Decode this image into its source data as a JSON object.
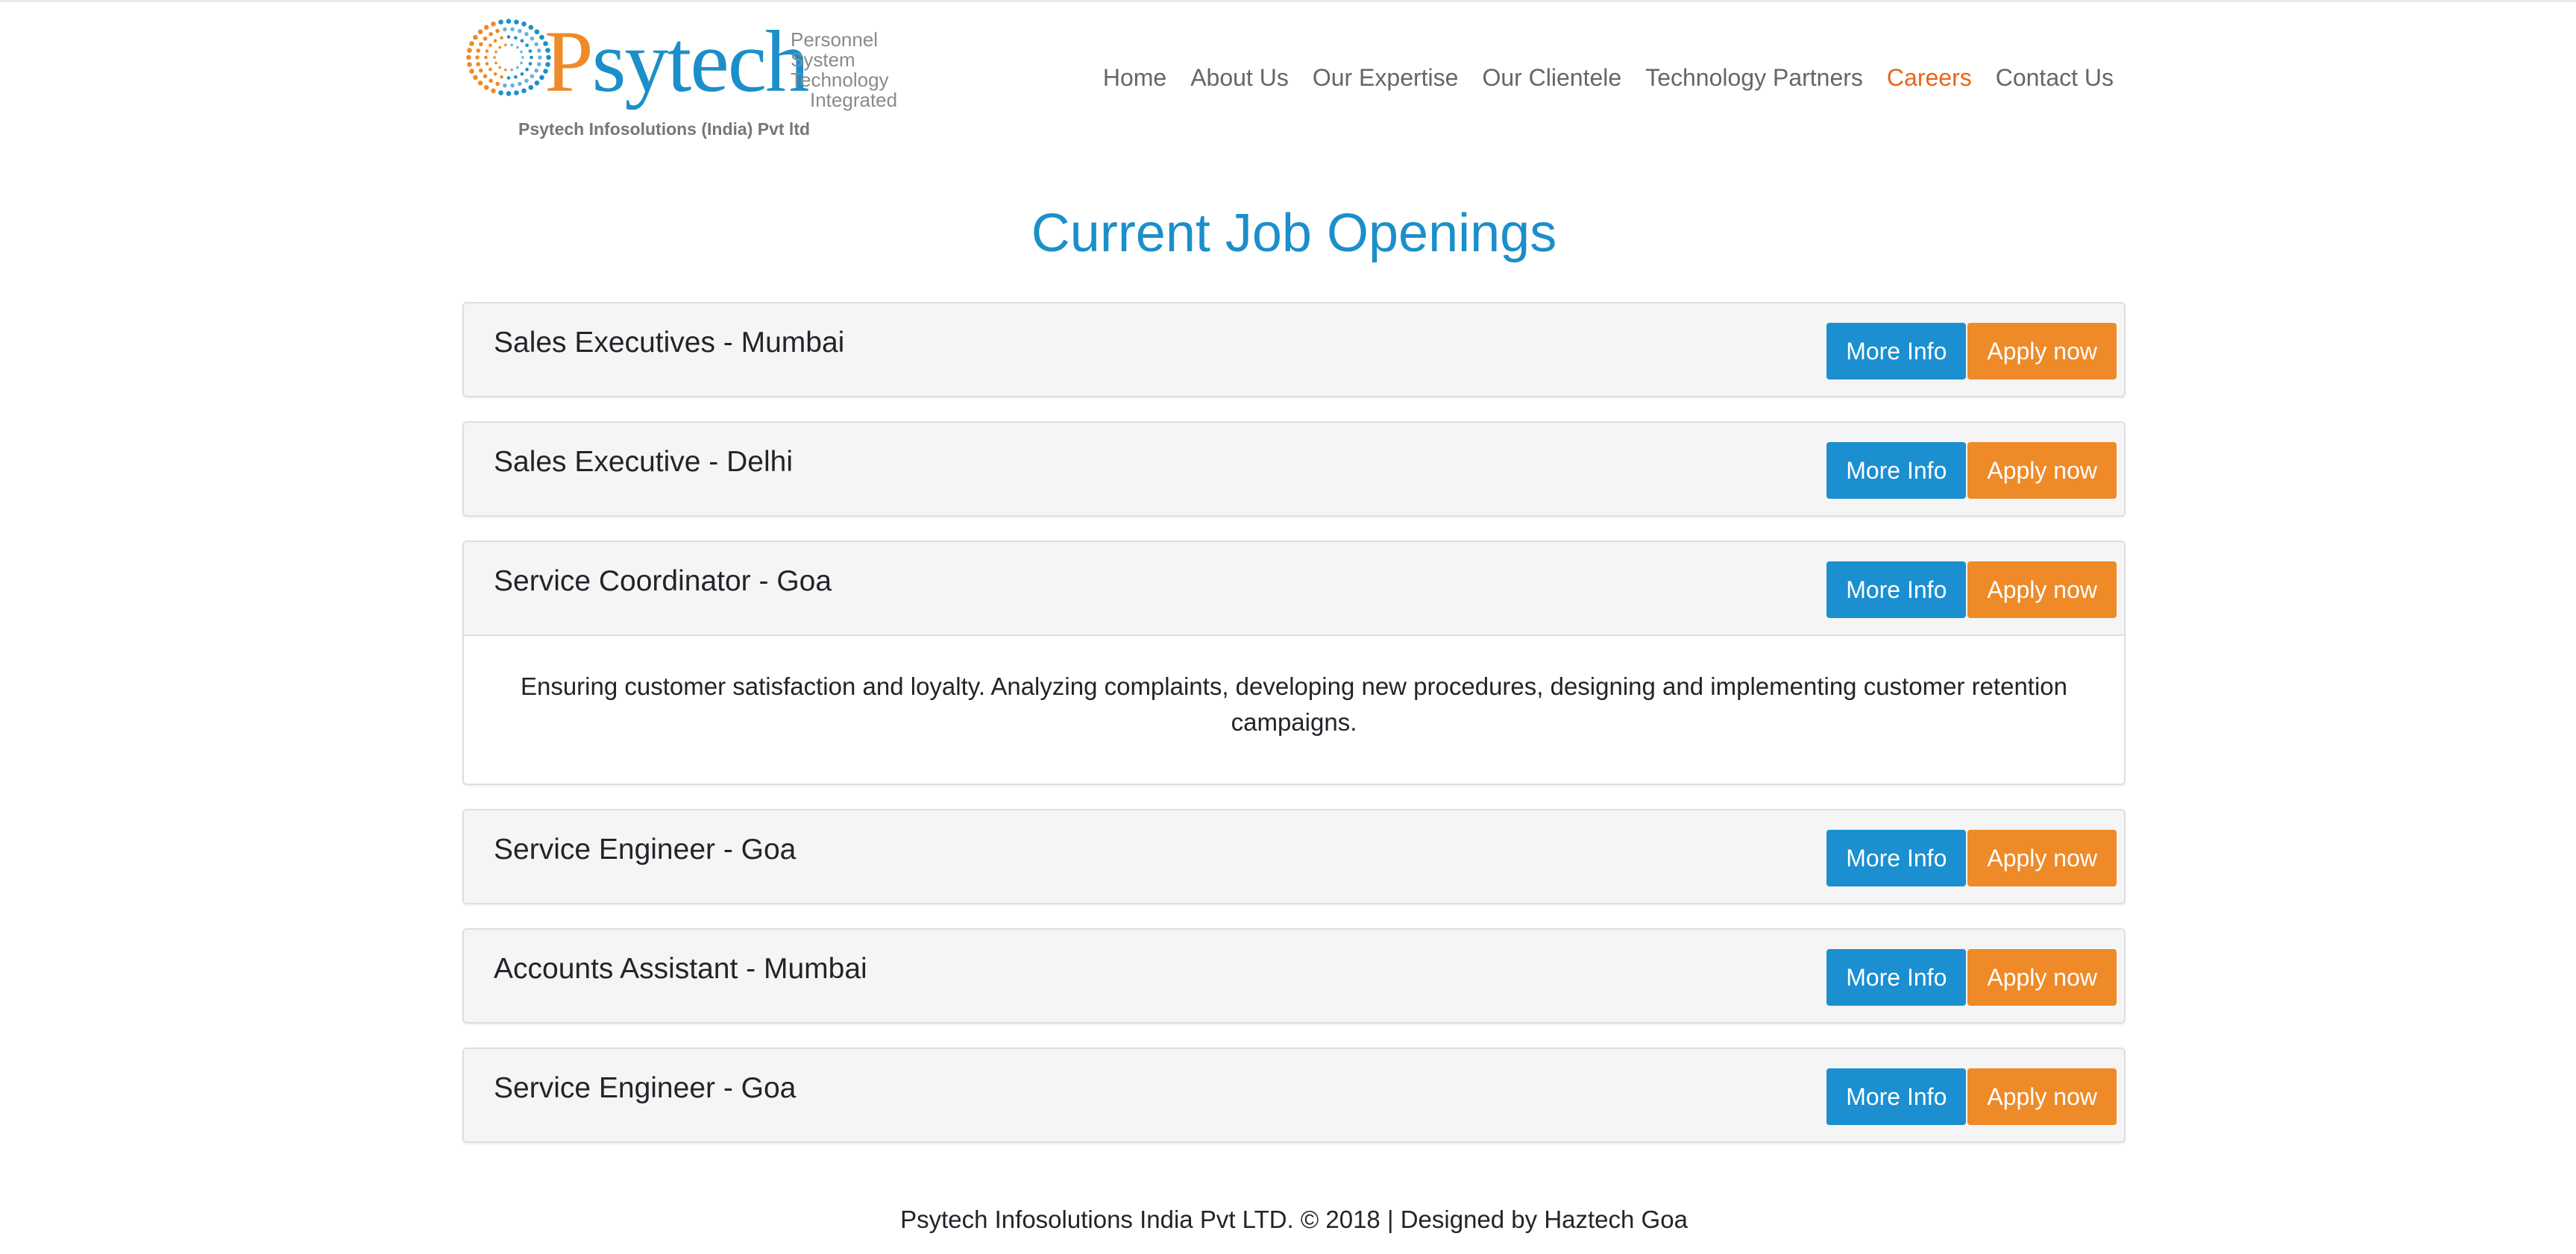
{
  "brand": {
    "logo_word_p": "P",
    "logo_word_rest": "sytech",
    "logo_tagline": [
      "Personnel",
      "System",
      "Technology",
      "Integrated"
    ],
    "company_name": "Psytech Infosolutions (India) Pvt ltd"
  },
  "nav": {
    "items": [
      {
        "label": "Home",
        "active": false
      },
      {
        "label": "About Us",
        "active": false
      },
      {
        "label": "Our Expertise",
        "active": false
      },
      {
        "label": "Our Clientele",
        "active": false
      },
      {
        "label": "Technology Partners",
        "active": false
      },
      {
        "label": "Careers",
        "active": true
      },
      {
        "label": "Contact Us",
        "active": false
      }
    ]
  },
  "page_title": "Current Job Openings",
  "jobs": [
    {
      "title": "Sales Executives - Mumbai",
      "more_label": "More Info",
      "apply_label": "Apply now",
      "expanded": false,
      "description": ""
    },
    {
      "title": "Sales Executive - Delhi",
      "more_label": "More Info",
      "apply_label": "Apply now",
      "expanded": false,
      "description": ""
    },
    {
      "title": "Service Coordinator - Goa",
      "more_label": "More Info",
      "apply_label": "Apply now",
      "expanded": true,
      "description": "Ensuring customer satisfaction and loyalty. Analyzing complaints, developing new procedures, designing and implementing customer retention campaigns."
    },
    {
      "title": "Service Engineer - Goa",
      "more_label": "More Info",
      "apply_label": "Apply now",
      "expanded": false,
      "description": ""
    },
    {
      "title": "Accounts Assistant - Mumbai",
      "more_label": "More Info",
      "apply_label": "Apply now",
      "expanded": false,
      "description": ""
    },
    {
      "title": "Service Engineer - Goa",
      "more_label": "More Info",
      "apply_label": "Apply now",
      "expanded": false,
      "description": ""
    }
  ],
  "footer": "Psytech Infosolutions India Pvt LTD. © 2018 | Designed by Haztech Goa",
  "colors": {
    "brand_blue": "#1b8fc9",
    "brand_orange": "#ef8a28",
    "nav_active": "#e8641e",
    "button_blue": "#1b8fd0"
  },
  "icons": [
    "psytech-dotted-swirl-logo-icon"
  ]
}
